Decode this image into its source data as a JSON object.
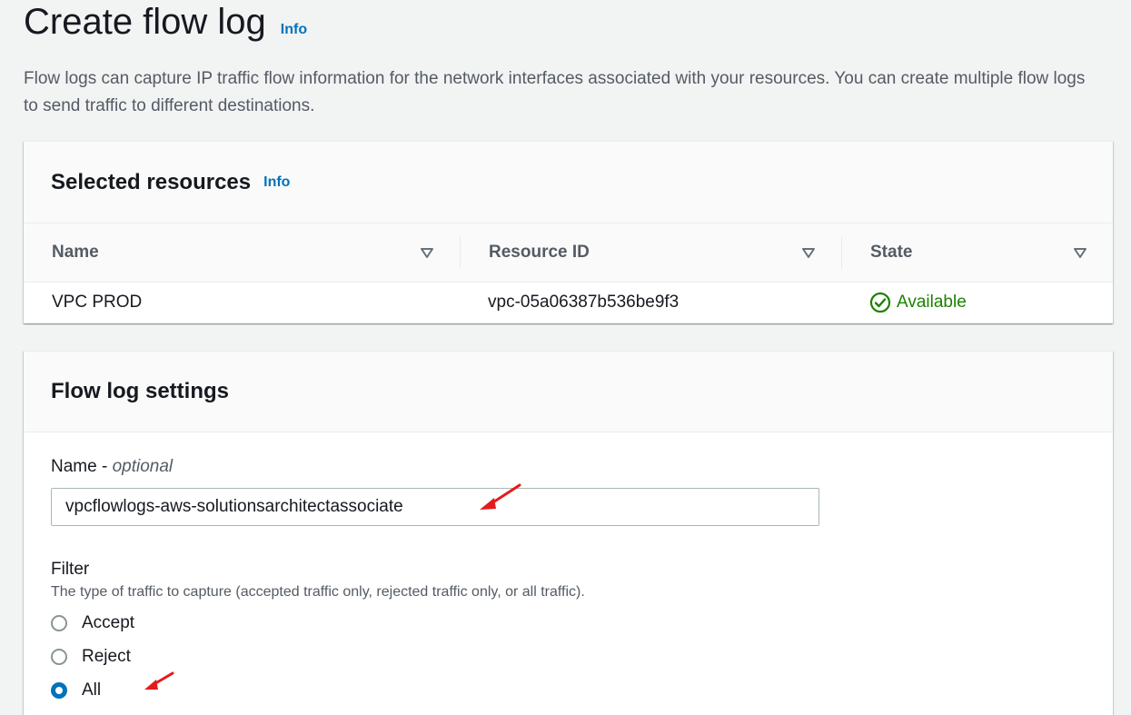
{
  "page": {
    "title": "Create flow log",
    "info_label": "Info",
    "description": "Flow logs can capture IP traffic flow information for the network interfaces associated with your resources. You can create multiple flow logs to send traffic to different destinations."
  },
  "resources": {
    "title": "Selected resources",
    "info_label": "Info",
    "columns": [
      "Name",
      "Resource ID",
      "State"
    ],
    "rows": [
      {
        "name": "VPC PROD",
        "resource_id": "vpc-05a06387b536be9f3",
        "state": "Available"
      }
    ]
  },
  "settings": {
    "title": "Flow log settings",
    "name_label": "Name - ",
    "name_optional": "optional",
    "name_value": "vpcflowlogs-aws-solutionsarchitectassociate",
    "filter_label": "Filter",
    "filter_desc": "The type of traffic to capture (accepted traffic only, rejected traffic only, or all traffic).",
    "filter_options": [
      "Accept",
      "Reject",
      "All"
    ],
    "filter_selected": "All"
  },
  "colors": {
    "link": "#0073bb",
    "success": "#1d8102",
    "annotation": "#e31c1c"
  }
}
